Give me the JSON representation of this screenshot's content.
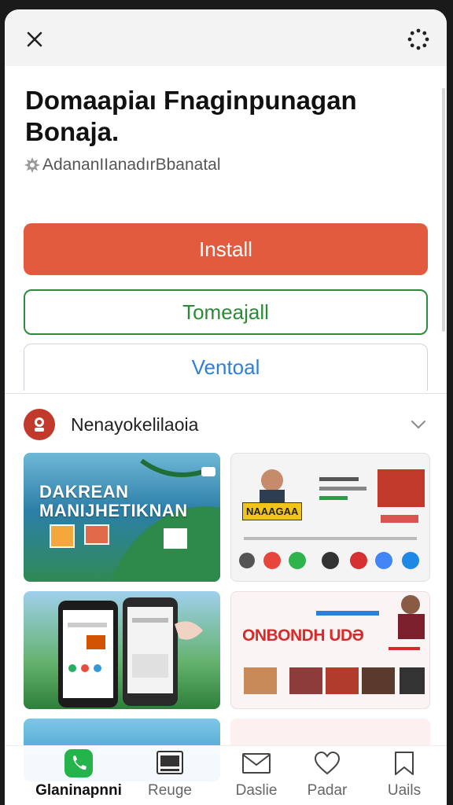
{
  "header": {
    "close_icon": "close-icon",
    "more_icon": "loading-dots-icon"
  },
  "app": {
    "title": "Domaapiaı Fnaginpunagan Bonaja.",
    "subtitle": "AdananIIanadırBbanatal",
    "subtitle_icon": "gear-badge-icon"
  },
  "buttons": {
    "install": "Install",
    "second": "Tomeajall",
    "third": "Ventoal"
  },
  "section": {
    "title": "Nenayokelilaoia",
    "expand_icon": "chevron-down-icon"
  },
  "screenshots": {
    "shot1_text": "DAKREAN MANIJHETIKNAN",
    "shot2_badge": "NAAAGAA",
    "shot4_headline": "ONBONDH UDƏ"
  },
  "tabbar": {
    "items": [
      {
        "label": "Glaninapnni",
        "icon": "phone-icon",
        "active": true
      },
      {
        "label": "Reuge",
        "icon": "media-icon",
        "active": false
      },
      {
        "label": "Daslie",
        "icon": "mail-icon",
        "active": false
      },
      {
        "label": "Padar",
        "icon": "heart-icon",
        "active": false
      },
      {
        "label": "Uails",
        "icon": "bookmark-icon",
        "active": false
      }
    ]
  },
  "colors": {
    "install_bg": "#e35b3f",
    "outline_green": "#2e8b3e",
    "link_blue": "#2f7fd6",
    "phone_green": "#25b34b"
  }
}
